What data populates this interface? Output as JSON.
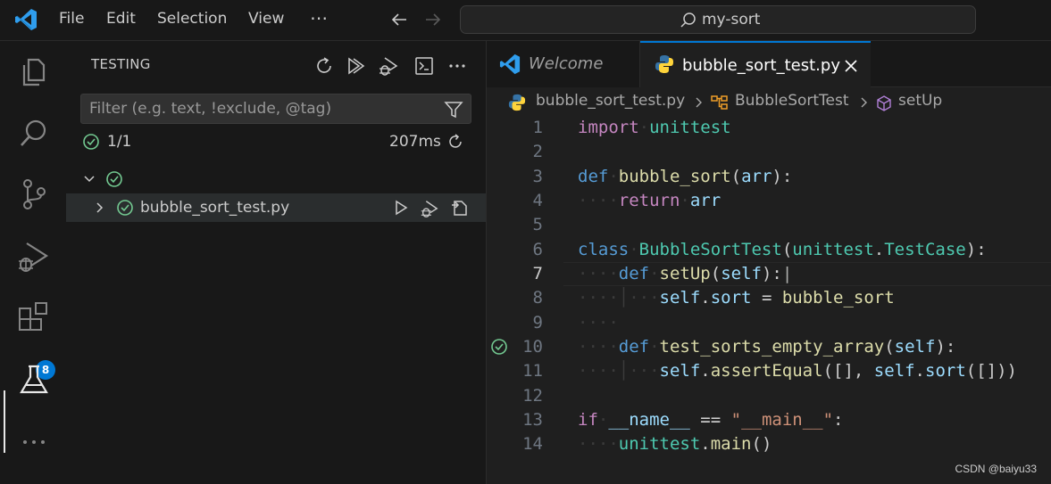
{
  "titlebar": {
    "menu": [
      "File",
      "Edit",
      "Selection",
      "View"
    ],
    "more_icon": "⋯",
    "search_text": "my-sort"
  },
  "activity_bar": {
    "items": [
      "explorer-icon",
      "search-icon",
      "source-control-icon",
      "run-debug-icon",
      "extensions-icon",
      "testing-icon",
      "more-icon"
    ],
    "extensions_badge": "8"
  },
  "sidebar": {
    "title": "TESTING",
    "filter_placeholder": "Filter (e.g. text, !exclude, @tag)",
    "summary_count": "1/1",
    "summary_time": "207ms",
    "tree_item": "bubble_sort_test.py"
  },
  "editor": {
    "tabs": [
      {
        "label": "Welcome",
        "active": false
      },
      {
        "label": "bubble_sort_test.py",
        "active": true
      }
    ],
    "breadcrumb": [
      "bubble_sort_test.py",
      "BubbleSortTest",
      "setUp"
    ],
    "line_numbers": [
      "1",
      "2",
      "3",
      "4",
      "5",
      "6",
      "7",
      "8",
      "9",
      "10",
      "11",
      "12",
      "13",
      "14"
    ],
    "current_line": "7",
    "code": {
      "l1": [
        "import",
        "unittest"
      ],
      "l3": [
        "def",
        "bubble_sort",
        "(",
        "arr",
        "):"
      ],
      "l4": [
        "return",
        "arr"
      ],
      "l6": [
        "class",
        "BubbleSortTest",
        "(",
        "unittest",
        ".",
        "TestCase",
        "):"
      ],
      "l7": [
        "def",
        "setUp",
        "(",
        "self",
        "):"
      ],
      "l8": [
        "self",
        ".",
        "sort",
        " = ",
        "bubble_sort"
      ],
      "l10": [
        "def",
        "test_sorts_empty_array",
        "(",
        "self",
        "):"
      ],
      "l11": [
        "self",
        ".",
        "assertEqual",
        "([], ",
        "self",
        ".",
        "sort",
        "([]))"
      ],
      "l13": [
        "if",
        "__name__",
        " == ",
        "\"__main__\"",
        ":"
      ],
      "l14": [
        "unittest",
        ".",
        "main",
        "()"
      ]
    }
  },
  "colors": {
    "accent": "#0078d4",
    "pass": "#73c991",
    "keyword": "#569cd6",
    "control": "#c586c0",
    "function": "#dcdcaa",
    "class": "#4ec9b0",
    "variable": "#9cdcfe",
    "string": "#ce9178"
  },
  "watermark": "CSDN @baiyu33"
}
